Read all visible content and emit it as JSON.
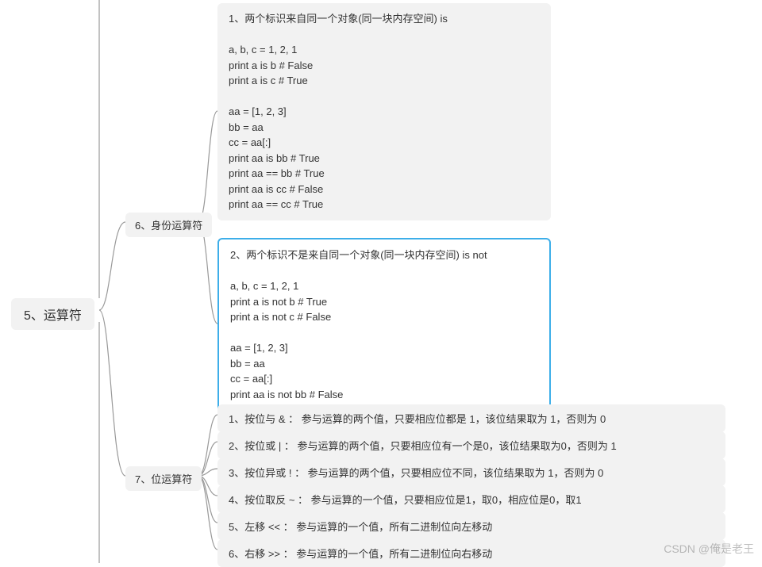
{
  "root": {
    "label": "5、运算符"
  },
  "identity": {
    "label": "6、身份运算符",
    "block1": "1、两个标识来自同一个对象(同一块内存空间) is\n\na, b, c = 1, 2, 1\nprint a is b # False\nprint a is c # True\n\naa = [1, 2, 3]\nbb = aa\ncc = aa[:]\nprint aa is bb # True\nprint aa == bb # True\nprint aa is cc # False\nprint aa == cc # True",
    "block2": "2、两个标识不是来自同一个对象(同一块内存空间) is not\n\na, b, c = 1, 2, 1\nprint a is not b # True\nprint a is not c # False\n\naa = [1, 2, 3]\nbb = aa\ncc = aa[:]\nprint aa is not bb # False\nprint aa is not cc # True"
  },
  "bitwise": {
    "label": "7、位运算符",
    "items": [
      "1、按位与 & ： 参与运算的两个值，只要相应位都是 1，该位结果取为 1，否则为 0",
      "2、按位或 | ： 参与运算的两个值，只要相应位有一个是0，该位结果取为0，否则为 1",
      "3、按位异或 ! ： 参与运算的两个值，只要相应位不同，该位结果取为 1，否则为 0",
      "4、按位取反 ~ ： 参与运算的一个值，只要相应位是1，取0，相应位是0，取1",
      "5、左移 << ： 参与运算的一个值，所有二进制位向左移动",
      "6、右移 >> ： 参与运算的一个值，所有二进制位向右移动"
    ]
  },
  "watermark": "CSDN @俺是老王"
}
